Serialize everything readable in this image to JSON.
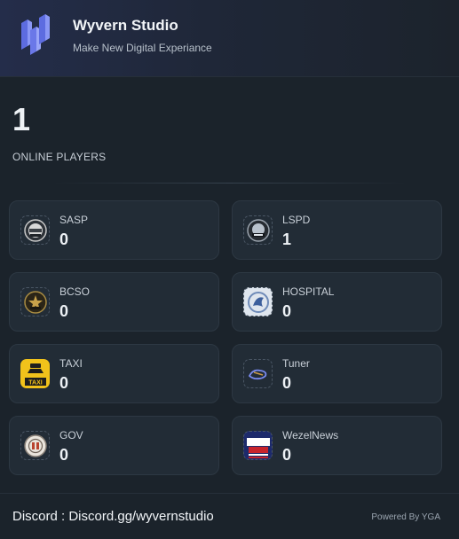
{
  "header": {
    "title": "Wyvern Studio",
    "subtitle": "Make New Digital Experiance"
  },
  "online": {
    "count": "1",
    "label": "ONLINE PLAYERS"
  },
  "departments": [
    {
      "name": "SASP",
      "value": "0",
      "icon": "sasp-badge-icon"
    },
    {
      "name": "LSPD",
      "value": "1",
      "icon": "lspd-badge-icon"
    },
    {
      "name": "BCSO",
      "value": "0",
      "icon": "bcso-badge-icon"
    },
    {
      "name": "HOSPITAL",
      "value": "0",
      "icon": "hospital-icon"
    },
    {
      "name": "TAXI",
      "value": "0",
      "icon": "taxi-icon"
    },
    {
      "name": "Tuner",
      "value": "0",
      "icon": "tuner-icon"
    },
    {
      "name": "GOV",
      "value": "0",
      "icon": "gov-seal-icon"
    },
    {
      "name": "WezelNews",
      "value": "0",
      "icon": "weazel-news-icon"
    }
  ],
  "footer": {
    "discord": "Discord : Discord.gg/wyvernstudio",
    "powered": "Powered By YGA"
  },
  "colors": {
    "background": "#1b232b",
    "card": "#222c36",
    "header_accent": "#242d4a",
    "logo": "#6f7ff0"
  }
}
